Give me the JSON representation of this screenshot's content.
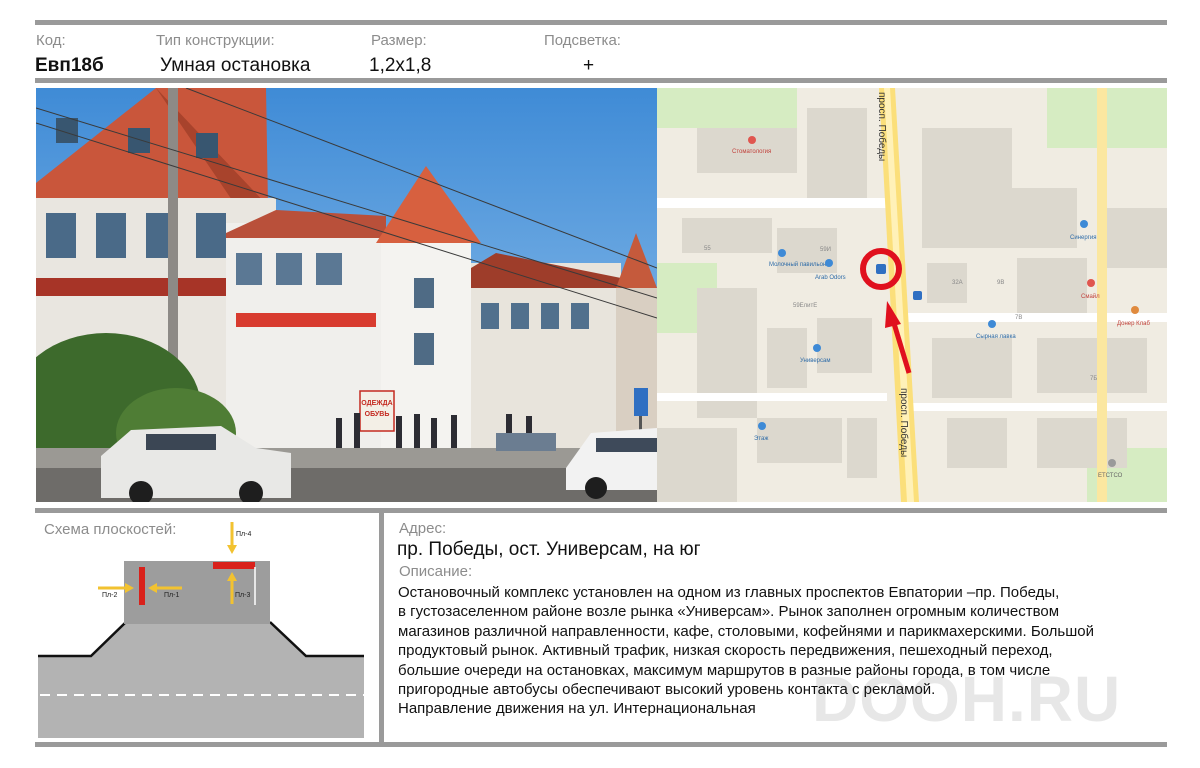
{
  "header": {
    "code_label": "Код:",
    "code_value": "Евп18б",
    "type_label": "Тип конструкции:",
    "type_value": "Умная остановка",
    "size_label": "Размер:",
    "size_value": "1,2х1,8",
    "light_label": "Подсветка:",
    "light_value": "+"
  },
  "photo": {
    "sign_text_1": "ОДЕЖДА",
    "sign_text_2": "ОБУВЬ"
  },
  "map": {
    "street_top": "просп. Победы",
    "street_bottom": "просп. Победы",
    "poi_dentistry": "Стоматология",
    "poi_milk": "Молочный павильон",
    "poi_arab": "Arab Odors",
    "poi_universam": "Универсам",
    "poi_etazh": "Этаж",
    "poi_synergy": "Синергия",
    "poi_smile": "Смайл",
    "poi_cheese": "Сырная лавка",
    "poi_doner": "Донер Клаб",
    "poi_etstso": "ЕТСТСО",
    "bld_59i": "59И",
    "bld_59elite": "59ЕлитЕ",
    "bld_55": "55",
    "bld_32a": "32А",
    "bld_9v": "9В",
    "bld_7v": "7В",
    "bld_7b": "7Б"
  },
  "scheme": {
    "title": "Схема плоскостей:",
    "pl1": "Пл-1",
    "pl2": "Пл-2",
    "pl3": "Пл-3",
    "pl4": "Пл-4"
  },
  "address": {
    "label": "Адрес:",
    "value": "пр. Победы, ост. Универсам, на юг"
  },
  "description": {
    "label": "Описание:",
    "text": "Остановочный комплекс установлен  на одном из главных проспектов Евпатории –пр. Победы,\nв густозаселенном районе возле рынка «Универсам». Рынок заполнен огромным количеством\nмагазинов различной направленности, кафе, столовыми, кофейнями и парикмахерскими. Большой\nпродуктовый рынок. Активный трафик, низкая скорость передвижения, пешеходный переход,\nбольшие очереди на остановках, максимум маршрутов в разные районы города, в том числе\nпригородные автобусы обеспечивают высокий уровень контакта с рекламой.\nНаправление движения на ул. Интернациональная"
  },
  "watermark": "DOOH.RU",
  "colors": {
    "divider": "#9a9a9a",
    "marker_red": "#e0101e",
    "plane_red": "#d9211b",
    "arrow_yellow": "#f2c230",
    "road_gray": "#b3b3b3"
  }
}
